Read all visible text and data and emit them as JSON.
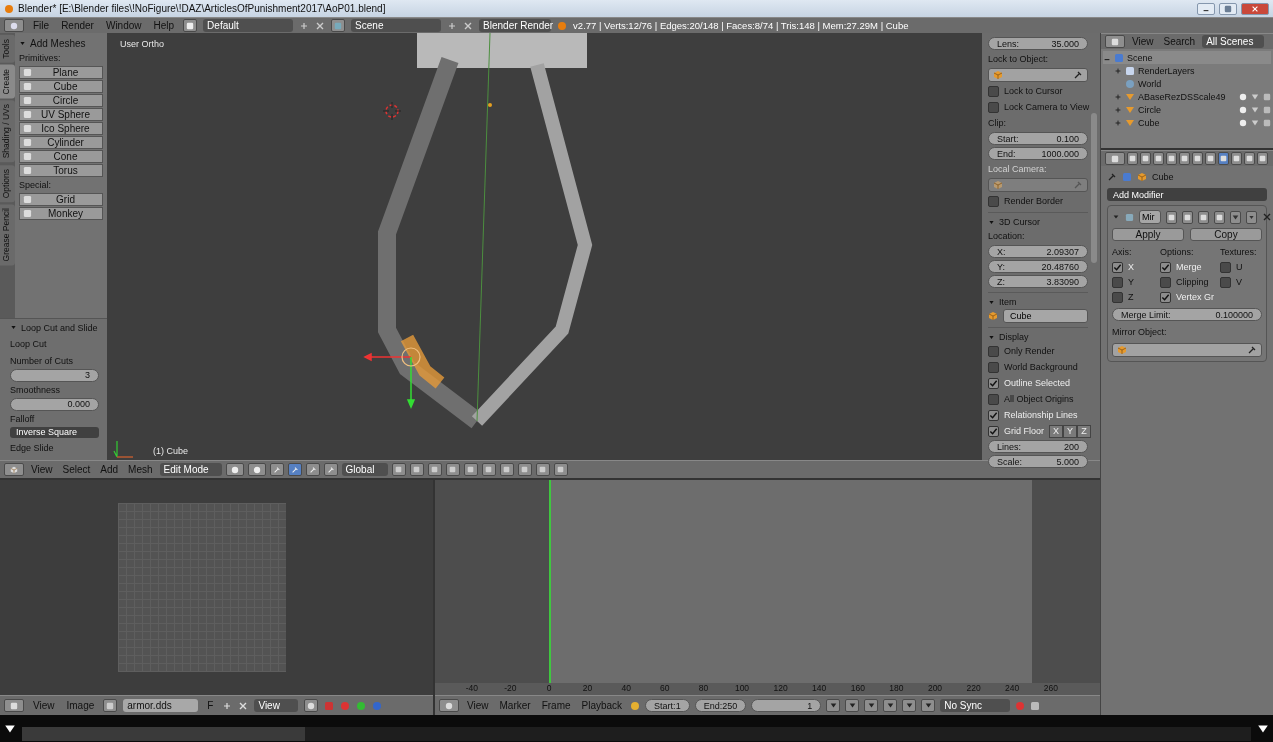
{
  "window": {
    "title": "Blender* [E:\\Blender files\\!NoFigure\\!DAZ\\ArticlesOfPunishment2017\\AoP01.blend]"
  },
  "info_header": {
    "menus": [
      "File",
      "Render",
      "Window",
      "Help"
    ],
    "layout": "Default",
    "scene": "Scene",
    "engine": "Blender Render",
    "stats": "v2.77 | Verts:12/76 | Edges:20/148 | Faces:8/74 | Tris:148 | Mem:27.29M | Cube"
  },
  "tool_tabs": [
    {
      "label": "Tools",
      "selected": false
    },
    {
      "label": "Create",
      "selected": true
    },
    {
      "label": "Shading / UVs",
      "selected": false
    },
    {
      "label": "Options",
      "selected": false
    },
    {
      "label": "Grease Pencil",
      "selected": false
    }
  ],
  "add_meshes": {
    "title": "Add Meshes",
    "primitives_label": "Primitives:",
    "primitives": [
      "Plane",
      "Cube",
      "Circle",
      "UV Sphere",
      "Ico Sphere",
      "Cylinder",
      "Cone",
      "Torus"
    ],
    "special_label": "Special:",
    "special": [
      "Grid",
      "Monkey"
    ]
  },
  "operator_panel": {
    "title": "Loop Cut and Slide",
    "subtitle": "Loop Cut",
    "fields": [
      {
        "label": "Number of Cuts",
        "value": "3"
      },
      {
        "label": "Smoothness",
        "value": "0.000"
      }
    ],
    "falloff_label": "Falloff",
    "falloff": "Inverse Square",
    "edge_slide": "Edge Slide"
  },
  "viewport": {
    "view_name": "User Ortho",
    "object_name": "(1) Cube"
  },
  "n_panel": {
    "lens": {
      "label": "Lens:",
      "value": "35.000"
    },
    "lock_label": "Lock to Object:",
    "view_checks": [
      {
        "label": "Lock to Cursor",
        "checked": false
      },
      {
        "label": "Lock Camera to View",
        "checked": false
      }
    ],
    "clip_label": "Clip:",
    "clip": [
      {
        "label": "Start:",
        "value": "0.100"
      },
      {
        "label": "End:",
        "value": "1000.000"
      }
    ],
    "local_camera": {
      "label": "Local Camera:",
      "disabled": true
    },
    "render_border": {
      "label": "Render Border",
      "checked": false
    },
    "cursor_title": "3D Cursor",
    "location_label": "Location:",
    "location": [
      {
        "label": "X:",
        "value": "2.09307"
      },
      {
        "label": "Y:",
        "value": "20.48760"
      },
      {
        "label": "Z:",
        "value": "3.83090"
      }
    ],
    "item_title": "Item",
    "item_name": "Cube",
    "display_title": "Display",
    "display_checks": [
      {
        "label": "Only Render",
        "checked": false
      },
      {
        "label": "World Background",
        "checked": false
      },
      {
        "label": "Outline Selected",
        "checked": true
      },
      {
        "label": "All Object Origins",
        "checked": false
      },
      {
        "label": "Relationship Lines",
        "checked": true
      },
      {
        "label": "Grid Floor",
        "checked": true
      }
    ],
    "grid_axes": [
      "X",
      "Y",
      "Z"
    ],
    "grid": [
      {
        "label": "Lines:",
        "value": "200"
      },
      {
        "label": "Scale:",
        "value": "5.000"
      }
    ]
  },
  "viewport_header": {
    "menus": [
      "View",
      "Select",
      "Add",
      "Mesh"
    ],
    "mode": "Edit Mode",
    "orientation": "Global"
  },
  "outliner": {
    "menus": [
      "View",
      "Search"
    ],
    "filter": "All Scenes",
    "tree": [
      {
        "label": "Scene",
        "kind": "scene",
        "expanded": true,
        "children": [
          {
            "label": "RenderLayers",
            "kind": "layers",
            "expanded": false
          },
          {
            "label": "World",
            "kind": "world"
          },
          {
            "label": "ABaseRezDSScale49",
            "kind": "mesh",
            "expanded": false
          },
          {
            "label": "Circle",
            "kind": "mesh",
            "expanded": false
          },
          {
            "label": "Cube",
            "kind": "mesh",
            "expanded": false
          }
        ]
      }
    ]
  },
  "properties": {
    "context_tabs": [
      {
        "selected": false
      },
      {
        "selected": false
      },
      {
        "selected": false
      },
      {
        "selected": false
      },
      {
        "selected": false
      },
      {
        "selected": false
      },
      {
        "selected": false
      },
      {
        "selected": true
      },
      {
        "selected": false
      },
      {
        "selected": false
      },
      {
        "selected": false
      }
    ],
    "object": "Cube",
    "add_modifier": "Add Modifier",
    "modifier": {
      "name": "Mir",
      "apply": "Apply",
      "copy": "Copy",
      "columns": [
        {
          "title": "Axis:",
          "options": [
            {
              "label": "X",
              "checked": true
            },
            {
              "label": "Y",
              "checked": false
            },
            {
              "label": "Z",
              "checked": false
            }
          ]
        },
        {
          "title": "Options:",
          "options": [
            {
              "label": "Merge",
              "checked": true
            },
            {
              "label": "Clipping",
              "checked": false
            },
            {
              "label": "Vertex Gr",
              "checked": true
            }
          ]
        },
        {
          "title": "Textures:",
          "options": [
            {
              "label": "U",
              "checked": false
            },
            {
              "label": "V",
              "checked": false
            }
          ]
        }
      ],
      "merge_limit": {
        "label": "Merge Limit:",
        "value": "0.100000"
      },
      "mirror_label": "Mirror Object:"
    }
  },
  "uv_header": {
    "menus": [
      "View",
      "Image"
    ],
    "image": "armor.dds",
    "fake_user": "F",
    "view": "View"
  },
  "timeline": {
    "ruler": [
      "-40",
      "-20",
      "0",
      "20",
      "40",
      "60",
      "80",
      "100",
      "120",
      "140",
      "160",
      "180",
      "200",
      "220",
      "240",
      "260"
    ],
    "menus": [
      "View",
      "Marker",
      "Frame",
      "Playback"
    ],
    "start": {
      "label": "Start:",
      "value": "1"
    },
    "end": {
      "label": "End:",
      "value": "250"
    },
    "current": "1",
    "sync": "No Sync"
  },
  "player": {
    "level": 0.23
  }
}
